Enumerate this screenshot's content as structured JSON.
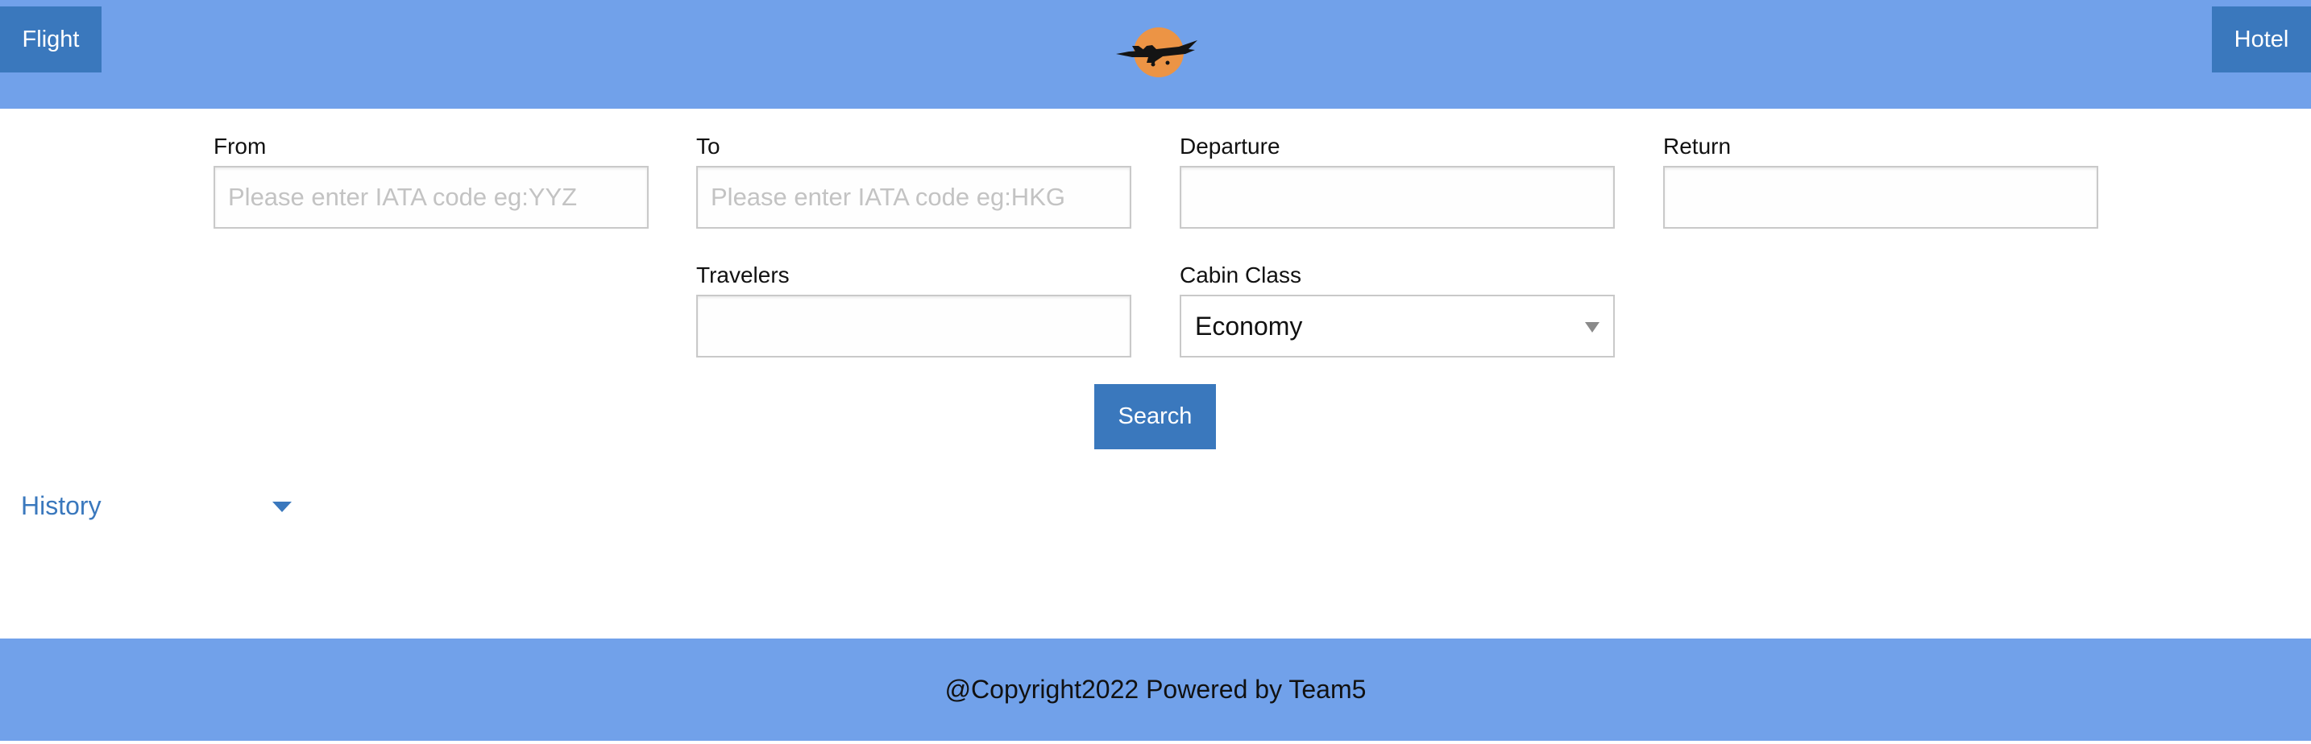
{
  "header": {
    "flight_label": "Flight",
    "hotel_label": "Hotel",
    "logo_icon": "fighter-jet-sun-logo",
    "bg_color": "#71a1ea",
    "button_color": "#3a78bd"
  },
  "form": {
    "from": {
      "label": "From",
      "placeholder": "Please enter IATA code eg:YYZ",
      "value": ""
    },
    "to": {
      "label": "To",
      "placeholder": "Please enter IATA code eg:HKG",
      "value": ""
    },
    "departure": {
      "label": "Departure",
      "value": ""
    },
    "return": {
      "label": "Return",
      "value": ""
    },
    "travelers": {
      "label": "Travelers",
      "value": ""
    },
    "cabin_class": {
      "label": "Cabin Class",
      "selected": "Economy"
    },
    "search_label": "Search"
  },
  "history": {
    "label": "History",
    "icon": "caret-down-icon"
  },
  "footer": {
    "text": "@Copyright2022 Powered by Team5"
  }
}
